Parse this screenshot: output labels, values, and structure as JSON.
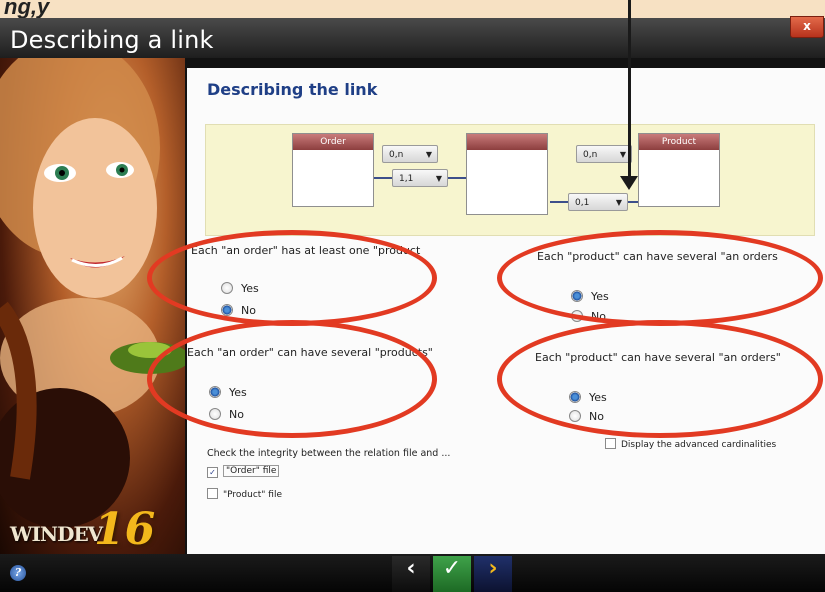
{
  "top_caption": "ng,y",
  "window": {
    "title": "Describing a link",
    "close_label": "x"
  },
  "content": {
    "title": "Describing the link"
  },
  "diagram": {
    "left_table": "Order",
    "right_table": "Product",
    "left_card_top": "0,n",
    "left_card_bottom": "1,1",
    "right_card_top": "0,n",
    "right_card_bottom": "0,1"
  },
  "questions": {
    "q1": {
      "text": "Each \"an order\" has at least one \"product",
      "options": [
        "Yes",
        "No"
      ],
      "selected": "No"
    },
    "q2": {
      "text": "Each \"product\" can have several \"an orders",
      "options": [
        "Yes",
        "No"
      ],
      "selected": "Yes"
    },
    "q3": {
      "text": "Each \"an order\" can have several \"products\"",
      "options": [
        "Yes",
        "No"
      ],
      "selected": "Yes"
    },
    "q4": {
      "text": "Each \"product\" can have several \"an orders\"",
      "options": [
        "Yes",
        "No"
      ],
      "selected": "Yes"
    }
  },
  "advanced": {
    "label": "Display the advanced cardinalities",
    "checked": false
  },
  "integrity": {
    "label": "Check the integrity between the relation file and ...",
    "items": [
      {
        "label": "\"Order\" file",
        "checked": true
      },
      {
        "label": "\"Product\" file",
        "checked": false
      }
    ]
  },
  "branding": {
    "name": "WINDEV",
    "version": "16"
  },
  "bottom_bar": {
    "help_label": "?",
    "prev_label": "‹",
    "ok_label": "✓",
    "next_label": "›"
  },
  "colors": {
    "annotation_red": "#e23a22",
    "title_blue": "#1f3f86",
    "ok_green": "#3fa24a"
  }
}
